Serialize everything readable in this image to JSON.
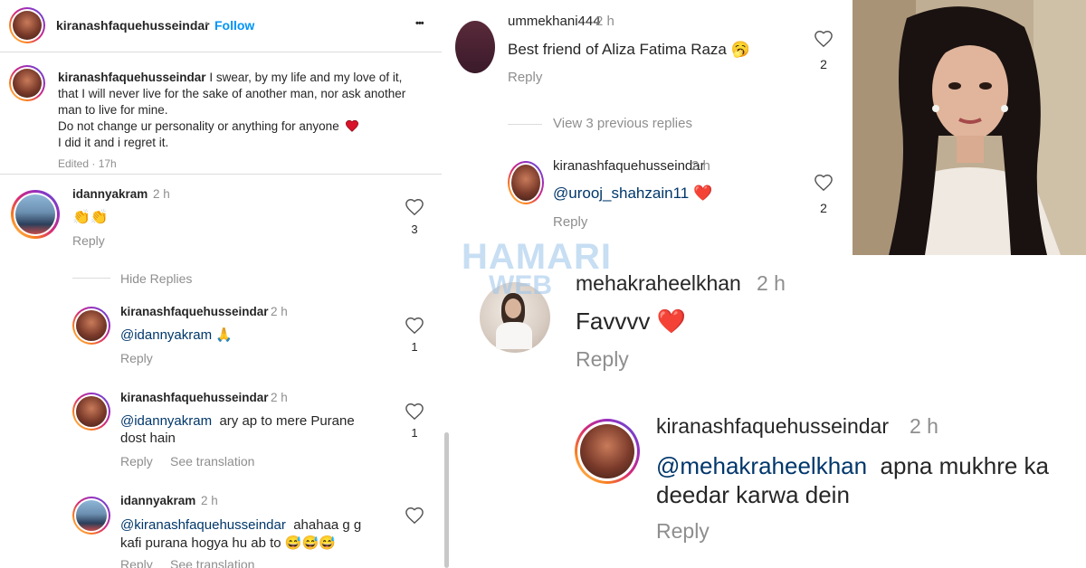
{
  "post": {
    "author": "kiranashfaquehusseindar",
    "dot": "•",
    "follow": "Follow",
    "more": "•••",
    "caption_lines": [
      "I swear, by my life and my love of it,",
      "that I will never live for the sake of another man, nor ask another",
      "man to live for mine.",
      "Do not change ur personality or anything for anyone",
      "I did it and i regret it."
    ],
    "edited": "Edited · 17h",
    "comments": [
      {
        "user": "idannyakram",
        "time": "2 h",
        "text": "👏👏",
        "reply": "Reply",
        "likes": "3"
      }
    ],
    "hide_replies": "Hide Replies",
    "replies": [
      {
        "user": "kiranashfaquehusseindar",
        "time": "2 h",
        "mention": "@idannyakram",
        "text": "🙏",
        "reply": "Reply",
        "likes": "1"
      },
      {
        "user": "kiranashfaquehusseindar",
        "time": "2 h",
        "mention": "@idannyakram",
        "text": "ary ap to mere Purane",
        "text2": "dost hain",
        "reply": "Reply",
        "see_translation": "See translation",
        "likes": "1"
      },
      {
        "user": "idannyakram",
        "time": "2 h",
        "mention": "@kiranashfaquehusseindar",
        "text": "ahahaa g g",
        "text2": "kafi purana hogya hu ab to 😅😅😅",
        "reply": "Reply",
        "see_translation": "See translation"
      }
    ]
  },
  "panel2": {
    "comment": {
      "user": "ummekhani444",
      "time": "2 h",
      "text": "Best friend of Aliza Fatima Raza 🥱",
      "reply": "Reply",
      "likes": "2"
    },
    "view_previous": "View 3 previous replies",
    "reply": {
      "user": "kiranashfaquehusseindar",
      "time": "2 h",
      "mention": "@urooj_shahzain11",
      "text": "❤️",
      "reply": "Reply",
      "likes": "2"
    }
  },
  "watermark": {
    "line1": "HAMARI",
    "line2": "WEB"
  },
  "panel4": {
    "comment": {
      "user": "mehakraheelkhan",
      "time": "2 h",
      "text": "Favvvv ❤️",
      "reply": "Reply"
    },
    "reply": {
      "user": "kiranashfaquehusseindar",
      "time": "2 h",
      "mention": "@mehakraheelkhan",
      "text": "apna mukhre ka",
      "text2": "deedar karwa dein",
      "reply": "Reply"
    }
  },
  "colors": {
    "link": "#00376b",
    "follow": "#0095f6",
    "muted": "#8e8e8e",
    "heart_red": "#ed4956"
  }
}
